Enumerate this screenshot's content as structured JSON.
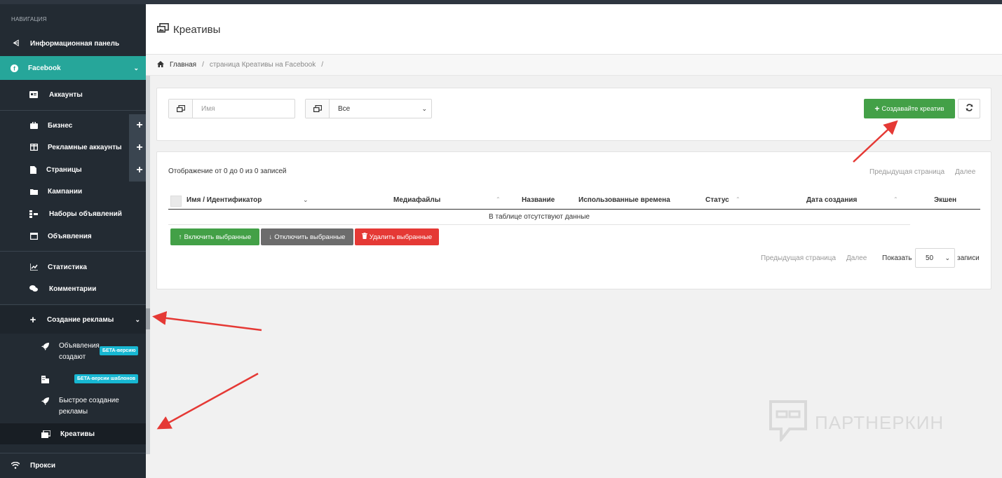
{
  "sidebar": {
    "heading": "НАВИГАЦИЯ",
    "dashboard": "Информационная панель",
    "facebook": "Facebook",
    "accounts": "Аккаунты",
    "business": "Бизнес",
    "ad_accounts": "Рекламные аккаунты",
    "pages": "Страницы",
    "campaigns": "Кампании",
    "adsets": "Наборы объявлений",
    "ads": "Объявления",
    "stats": "Статистика",
    "comments": "Комментарии",
    "create_ads": "Создание рекламы",
    "sub_ads_create_1": "Объявления",
    "sub_ads_create_2": "создают",
    "beta_badge": "БЕТА-версию",
    "beta_templates_badge": "БЕТА-версии шаблонов",
    "quick_create_1": "Быстрое создание",
    "quick_create_2": "рекламы",
    "creatives": "Креативы",
    "proxy": "Прокси"
  },
  "header": {
    "title": "Креативы"
  },
  "breadcrumb": {
    "home": "Главная",
    "sep": "/",
    "current": "страница Креативы на Facebook"
  },
  "filters": {
    "name_placeholder": "Имя",
    "select_value": "Все",
    "create_button": "Создавайте креатив"
  },
  "table": {
    "info": "Отображение от 0 до 0 из 0 записей",
    "prev": "Предыдущая страница",
    "next": "Далее",
    "columns": [
      "Имя / Идентификатор",
      "Медиафайлы",
      "Название",
      "Использованные времена",
      "Статус",
      "Дата создания",
      "Экшен"
    ],
    "empty": "В таблице отсутствуют данные",
    "enable_selected": "Включить выбранные",
    "disable_selected": "Отключить выбранные",
    "delete_selected": "Удалить выбранные",
    "show_label": "Показать",
    "page_size": "50",
    "records_label": "записи"
  },
  "watermark": "ПАРТНЕРКИН",
  "colors": {
    "sidebar": "#232b33",
    "accent": "#26a69a",
    "green": "#43a047",
    "red": "#e53935",
    "annotation": "#e53935"
  }
}
